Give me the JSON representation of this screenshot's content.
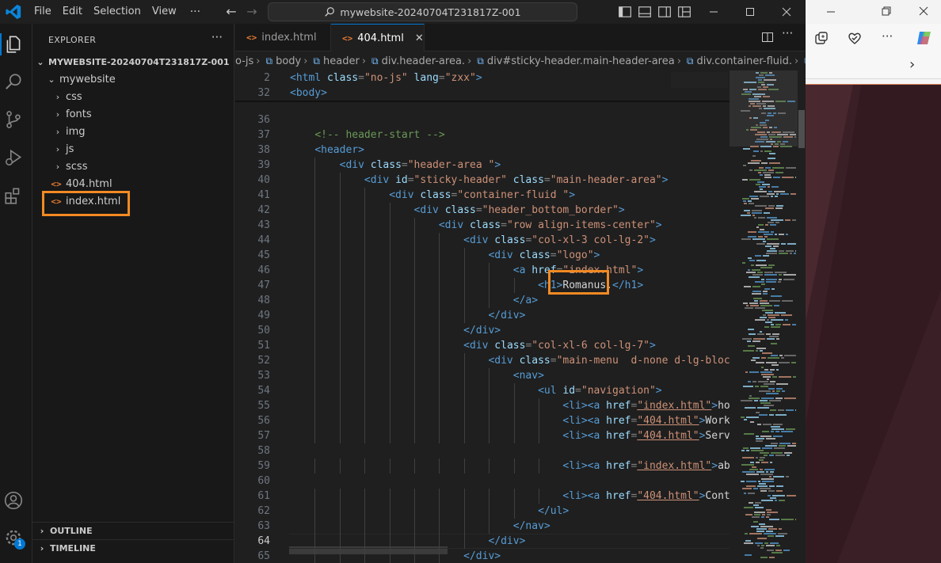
{
  "menu": [
    "File",
    "Edit",
    "Selection",
    "View"
  ],
  "menu_more": "···",
  "command_center": "mywebsite-20240704T231817Z-001",
  "sidebar": {
    "title": "EXPLORER",
    "more": "···",
    "project": "MYWEBSITE-20240704T231817Z-001",
    "folder": "mywebsite",
    "items": [
      {
        "label": "css",
        "kind": "folder"
      },
      {
        "label": "fonts",
        "kind": "folder"
      },
      {
        "label": "img",
        "kind": "folder"
      },
      {
        "label": "js",
        "kind": "folder"
      },
      {
        "label": "scss",
        "kind": "folder"
      },
      {
        "label": "404.html",
        "kind": "file"
      },
      {
        "label": "index.html",
        "kind": "file"
      }
    ],
    "outline": "OUTLINE",
    "timeline": "TIMELINE"
  },
  "tabs": [
    {
      "label": "index.html",
      "active": false
    },
    {
      "label": "404.html",
      "active": true
    }
  ],
  "breadcrumbs": [
    "o-js",
    "body",
    "header",
    "div.header-area.",
    "div#sticky-header.main-header-area",
    "div.container-fluid.",
    "div"
  ],
  "accounts_badge": "1",
  "code_lines": [
    {
      "n": "2",
      "parts": [
        [
          "tag",
          "<html "
        ],
        [
          "attr",
          "class"
        ],
        [
          "br",
          "="
        ],
        [
          "str",
          "\"no-js\""
        ],
        [
          "attr",
          " lang"
        ],
        [
          "br",
          "="
        ],
        [
          "str",
          "\"zxx\""
        ],
        [
          "tag",
          ">"
        ]
      ]
    },
    {
      "n": "32",
      "parts": [
        [
          "tag",
          "<body>"
        ]
      ]
    },
    {
      "n": "36",
      "parts": []
    },
    {
      "n": "37",
      "parts": [
        [
          "txt",
          "    "
        ],
        [
          "cmt",
          "<!-- header-start -->"
        ]
      ]
    },
    {
      "n": "38",
      "parts": [
        [
          "txt",
          "    "
        ],
        [
          "tag",
          "<header>"
        ]
      ]
    },
    {
      "n": "39",
      "parts": [
        [
          "txt",
          "        "
        ],
        [
          "tag",
          "<div "
        ],
        [
          "attr",
          "class"
        ],
        [
          "br",
          "="
        ],
        [
          "str",
          "\"header-area \""
        ],
        [
          "tag",
          ">"
        ]
      ]
    },
    {
      "n": "40",
      "parts": [
        [
          "txt",
          "            "
        ],
        [
          "tag",
          "<div "
        ],
        [
          "attr",
          "id"
        ],
        [
          "br",
          "="
        ],
        [
          "str",
          "\"sticky-header\""
        ],
        [
          "attr",
          " class"
        ],
        [
          "br",
          "="
        ],
        [
          "str",
          "\"main-header-area\""
        ],
        [
          "tag",
          ">"
        ]
      ]
    },
    {
      "n": "41",
      "parts": [
        [
          "txt",
          "                "
        ],
        [
          "tag",
          "<div "
        ],
        [
          "attr",
          "class"
        ],
        [
          "br",
          "="
        ],
        [
          "str",
          "\"container-fluid \""
        ],
        [
          "tag",
          ">"
        ]
      ]
    },
    {
      "n": "42",
      "parts": [
        [
          "txt",
          "                    "
        ],
        [
          "tag",
          "<div "
        ],
        [
          "attr",
          "class"
        ],
        [
          "br",
          "="
        ],
        [
          "str",
          "\"header_bottom_border\""
        ],
        [
          "tag",
          ">"
        ]
      ]
    },
    {
      "n": "43",
      "parts": [
        [
          "txt",
          "                        "
        ],
        [
          "tag",
          "<div "
        ],
        [
          "attr",
          "class"
        ],
        [
          "br",
          "="
        ],
        [
          "str",
          "\"row align-items-center\""
        ],
        [
          "tag",
          ">"
        ]
      ]
    },
    {
      "n": "44",
      "parts": [
        [
          "txt",
          "                            "
        ],
        [
          "tag",
          "<div "
        ],
        [
          "attr",
          "class"
        ],
        [
          "br",
          "="
        ],
        [
          "str",
          "\"col-xl-3 col-lg-2\""
        ],
        [
          "tag",
          ">"
        ]
      ]
    },
    {
      "n": "45",
      "parts": [
        [
          "txt",
          "                                "
        ],
        [
          "tag",
          "<div "
        ],
        [
          "attr",
          "class"
        ],
        [
          "br",
          "="
        ],
        [
          "str",
          "\"logo\""
        ],
        [
          "tag",
          ">"
        ]
      ]
    },
    {
      "n": "46",
      "parts": [
        [
          "txt",
          "                                    "
        ],
        [
          "tag",
          "<a "
        ],
        [
          "attr",
          "href"
        ],
        [
          "br",
          "="
        ],
        [
          "str",
          "\"index.html\""
        ],
        [
          "tag",
          ">"
        ]
      ]
    },
    {
      "n": "47",
      "parts": [
        [
          "txt",
          "                                        "
        ],
        [
          "tag",
          "<h1>"
        ],
        [
          "txt",
          "Romanus."
        ],
        [
          "tag",
          "</h1>"
        ]
      ]
    },
    {
      "n": "48",
      "parts": [
        [
          "txt",
          "                                    "
        ],
        [
          "tag",
          "</a>"
        ]
      ]
    },
    {
      "n": "49",
      "parts": [
        [
          "txt",
          "                                "
        ],
        [
          "tag",
          "</div>"
        ]
      ]
    },
    {
      "n": "50",
      "parts": [
        [
          "txt",
          "                            "
        ],
        [
          "tag",
          "</div>"
        ]
      ]
    },
    {
      "n": "51",
      "parts": [
        [
          "txt",
          "                            "
        ],
        [
          "tag",
          "<div "
        ],
        [
          "attr",
          "class"
        ],
        [
          "br",
          "="
        ],
        [
          "str",
          "\"col-xl-6 col-lg-7\""
        ],
        [
          "tag",
          ">"
        ]
      ]
    },
    {
      "n": "52",
      "parts": [
        [
          "txt",
          "                                "
        ],
        [
          "tag",
          "<div "
        ],
        [
          "attr",
          "class"
        ],
        [
          "br",
          "="
        ],
        [
          "str",
          "\"main-menu  d-none d-lg-block\""
        ],
        [
          "tag",
          ">"
        ]
      ]
    },
    {
      "n": "53",
      "parts": [
        [
          "txt",
          "                                    "
        ],
        [
          "tag",
          "<nav>"
        ]
      ]
    },
    {
      "n": "54",
      "parts": [
        [
          "txt",
          "                                        "
        ],
        [
          "tag",
          "<ul "
        ],
        [
          "attr",
          "id"
        ],
        [
          "br",
          "="
        ],
        [
          "str",
          "\"navigation\""
        ],
        [
          "tag",
          ">"
        ]
      ]
    },
    {
      "n": "55",
      "parts": [
        [
          "txt",
          "                                            "
        ],
        [
          "tag",
          "<li><a "
        ],
        [
          "attr",
          "href"
        ],
        [
          "br",
          "="
        ],
        [
          "strl",
          "\"index.html\""
        ],
        [
          "tag",
          ">"
        ],
        [
          "txt",
          "home"
        ]
      ]
    },
    {
      "n": "56",
      "parts": [
        [
          "txt",
          "                                            "
        ],
        [
          "tag",
          "<li><a "
        ],
        [
          "attr",
          "href"
        ],
        [
          "br",
          "="
        ],
        [
          "strl",
          "\"404.html\""
        ],
        [
          "tag",
          ">"
        ],
        [
          "txt",
          "Works"
        ]
      ]
    },
    {
      "n": "57",
      "parts": [
        [
          "txt",
          "                                            "
        ],
        [
          "tag",
          "<li><a "
        ],
        [
          "attr",
          "href"
        ],
        [
          "br",
          "="
        ],
        [
          "strl",
          "\"404.html\""
        ],
        [
          "tag",
          ">"
        ],
        [
          "txt",
          "Servic"
        ]
      ]
    },
    {
      "n": "58",
      "parts": []
    },
    {
      "n": "59",
      "parts": [
        [
          "txt",
          "                                            "
        ],
        [
          "tag",
          "<li><a "
        ],
        [
          "attr",
          "href"
        ],
        [
          "br",
          "="
        ],
        [
          "strl",
          "\"index.html\""
        ],
        [
          "tag",
          ">"
        ],
        [
          "txt",
          "abou"
        ]
      ]
    },
    {
      "n": "60",
      "parts": []
    },
    {
      "n": "61",
      "parts": [
        [
          "txt",
          "                                            "
        ],
        [
          "tag",
          "<li><a "
        ],
        [
          "attr",
          "href"
        ],
        [
          "br",
          "="
        ],
        [
          "strl",
          "\"404.html\""
        ],
        [
          "tag",
          ">"
        ],
        [
          "txt",
          "Conta"
        ]
      ]
    },
    {
      "n": "62",
      "parts": [
        [
          "txt",
          "                                        "
        ],
        [
          "tag",
          "</ul>"
        ]
      ]
    },
    {
      "n": "63",
      "parts": [
        [
          "txt",
          "                                    "
        ],
        [
          "tag",
          "</nav>"
        ]
      ]
    },
    {
      "n": "64",
      "parts": [
        [
          "txt",
          "                                "
        ],
        [
          "tag",
          "</div>"
        ]
      ],
      "current": true
    },
    {
      "n": "65",
      "parts": [
        [
          "txt",
          "                            "
        ],
        [
          "tag",
          "</div>"
        ]
      ]
    }
  ]
}
